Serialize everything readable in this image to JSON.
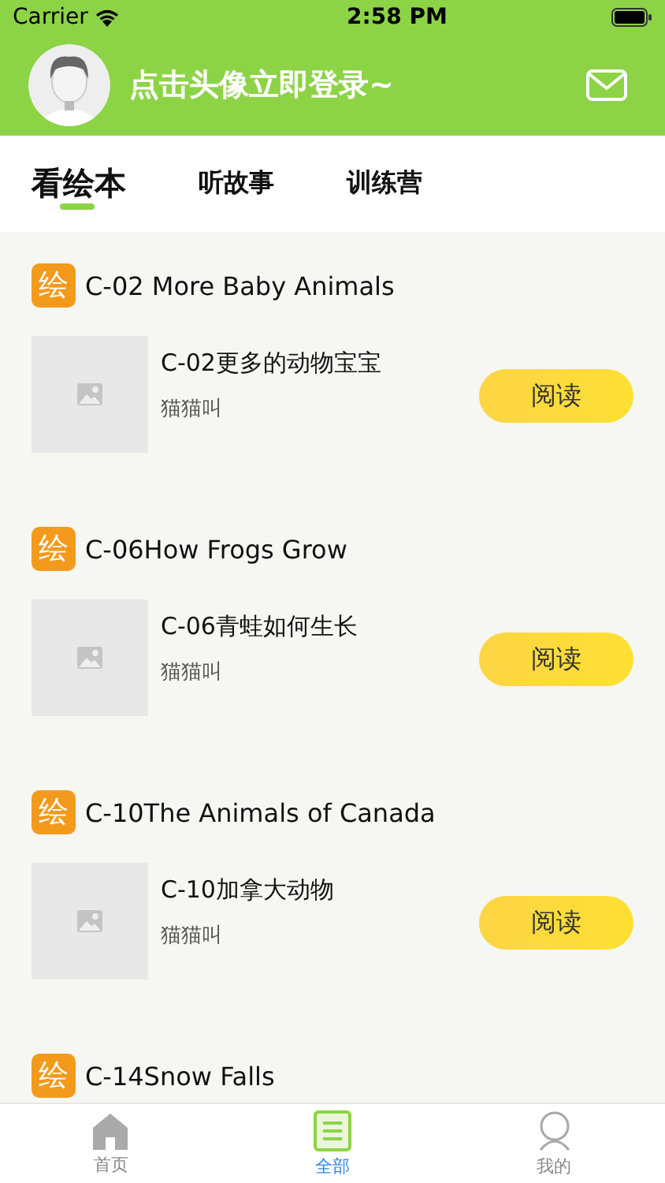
{
  "status_bar": {
    "carrier": "Carrier",
    "time": "2:58 PM"
  },
  "header": {
    "login_prompt": "点击头像立即登录~"
  },
  "tabs": [
    {
      "label": "看绘本",
      "selected": true
    },
    {
      "label": "听故事",
      "selected": false
    },
    {
      "label": "训练营",
      "selected": false
    }
  ],
  "books": [
    {
      "badge": "绘",
      "title": "C-02 More Baby Animals",
      "subtitle": "C-02更多的动物宝宝",
      "author": "猫猫叫",
      "button": "阅读"
    },
    {
      "badge": "绘",
      "title": "C-06How Frogs Grow",
      "subtitle": "C-06青蛙如何生长",
      "author": "猫猫叫",
      "button": "阅读"
    },
    {
      "badge": "绘",
      "title": "C-10The Animals of Canada",
      "subtitle": "C-10加拿大动物",
      "author": "猫猫叫",
      "button": "阅读"
    },
    {
      "badge": "绘",
      "title": "C-14Snow Falls"
    }
  ],
  "tab_bar": [
    {
      "label": "首页",
      "kind": "home",
      "selected": false
    },
    {
      "label": "全部",
      "kind": "book",
      "selected": true
    },
    {
      "label": "我的",
      "kind": "person",
      "selected": false
    }
  ]
}
